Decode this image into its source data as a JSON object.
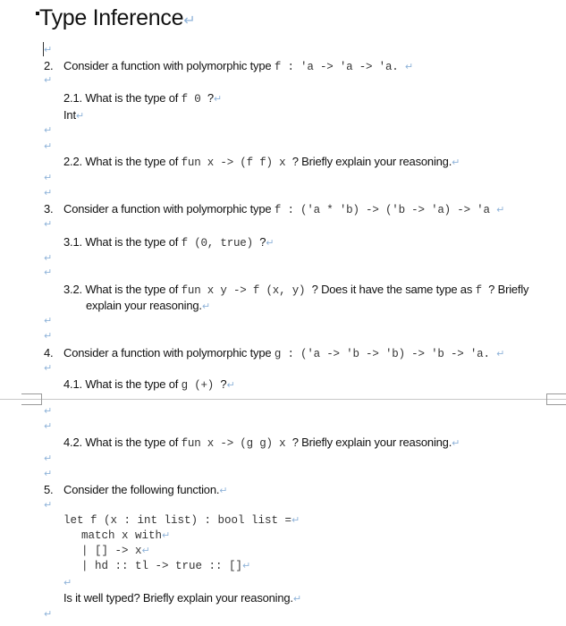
{
  "document": {
    "title": "Type Inference",
    "para_mark": "↵",
    "q2": {
      "number": "2.",
      "text": "Consider a function with polymorphic type ",
      "code": "f : 'a -> 'a -> 'a."
    },
    "q2_1": {
      "number": "2.1.",
      "text": "What is the type of ",
      "code": "f 0",
      "suffix": " ?",
      "answer": "Int"
    },
    "q2_2": {
      "number": "2.2.",
      "text": "What is the type of ",
      "code": "fun x -> (f f) x",
      "suffix": " ? Briefly explain your reasoning."
    },
    "q3": {
      "number": "3.",
      "text": "Consider a function with polymorphic type ",
      "code": "f : ('a * 'b) -> ('b -> 'a) -> 'a"
    },
    "q3_1": {
      "number": "3.1.",
      "text": "What is the type of ",
      "code": "f (0, true)",
      "suffix": " ?"
    },
    "q3_2": {
      "number": "3.2.",
      "text": "What is the type of ",
      "code": "fun x y -> f (x, y)",
      "mid": " ? Does it have the same type as ",
      "code2": "f",
      "suffix": " ? Briefly",
      "line2": "explain your reasoning."
    },
    "q4": {
      "number": "4.",
      "text": "Consider a function with polymorphic type ",
      "code": "g : ('a -> 'b -> 'b) -> 'b -> 'a."
    },
    "q4_1": {
      "number": "4.1.",
      "text": "What is the type of ",
      "code": "g (+)",
      "suffix": " ?"
    },
    "q4_2": {
      "number": "4.2.",
      "text": "What is the type of ",
      "code": "fun x -> (g g) x",
      "suffix": " ? Briefly explain your reasoning."
    },
    "q5": {
      "number": "5.",
      "text": "Consider the following function.",
      "code_lines": [
        "let f (x : int list) : bool list =",
        "match x with",
        "| [] -> x",
        "| hd :: tl -> true :: []"
      ],
      "question": "Is it well typed? Briefly explain your reasoning."
    }
  }
}
